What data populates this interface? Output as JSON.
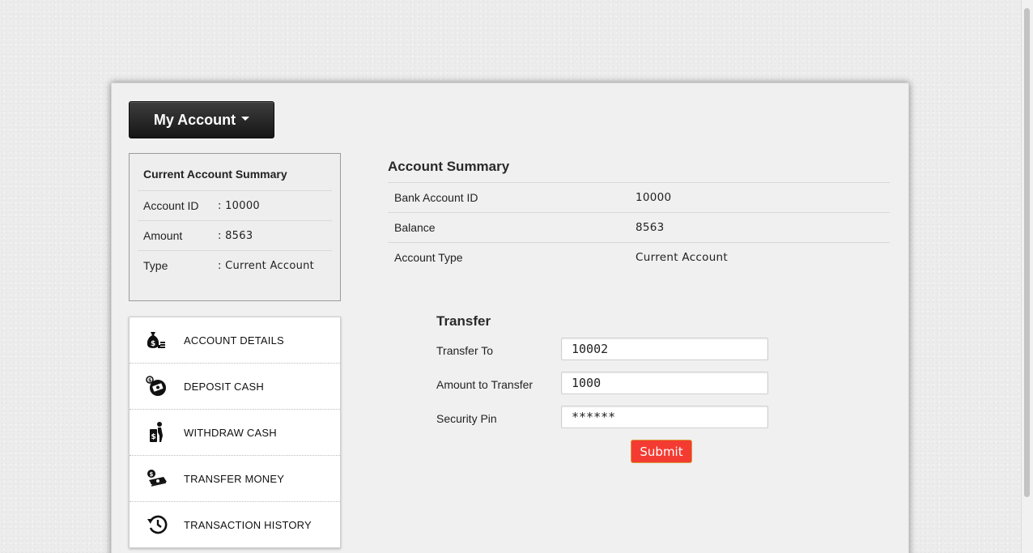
{
  "header": {
    "account_button_label": "My Account"
  },
  "current_summary": {
    "title": "Current Account Summary",
    "rows": [
      {
        "label": "Account ID",
        "value": ": 10000"
      },
      {
        "label": "Amount",
        "value": ": 8563"
      },
      {
        "label": "Type",
        "value": ": Current  Account"
      }
    ]
  },
  "menu": {
    "items": [
      {
        "label": "ACCOUNT DETAILS",
        "icon": "money-bag-icon"
      },
      {
        "label": "DEPOSIT CASH",
        "icon": "deposit-cash-icon"
      },
      {
        "label": "WITHDRAW CASH",
        "icon": "withdraw-cash-icon"
      },
      {
        "label": "TRANSFER MONEY",
        "icon": "transfer-money-icon"
      },
      {
        "label": "TRANSACTION HISTORY",
        "icon": "history-icon"
      }
    ]
  },
  "account_summary": {
    "title": "Account Summary",
    "rows": [
      {
        "label": "Bank Account ID",
        "value": "10000"
      },
      {
        "label": "Balance",
        "value": "8563"
      },
      {
        "label": "Account Type",
        "value": "Current  Account"
      }
    ]
  },
  "transfer": {
    "title": "Transfer",
    "transfer_to_label": "Transfer To",
    "transfer_to_value": "10002",
    "amount_label": "Amount to Transfer",
    "amount_value": "1000",
    "pin_label": "Security Pin",
    "pin_value": "******",
    "submit_label": "Submit"
  },
  "colors": {
    "submit_bg": "#f43b32",
    "button_dark": "#1e1e1e"
  }
}
